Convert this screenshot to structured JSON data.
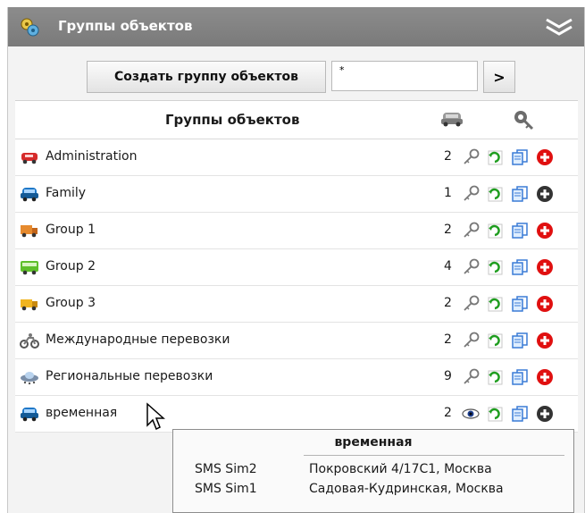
{
  "window": {
    "title": "Группы объектов"
  },
  "toolbar": {
    "create_label": "Создать группу объектов",
    "search_value": "*",
    "next_label": ">"
  },
  "table": {
    "header": "Группы объектов",
    "rows": [
      {
        "name": "Administration",
        "count": "2",
        "icon": "red-car-icon",
        "deletable": true,
        "viewonly": false
      },
      {
        "name": "Family",
        "count": "1",
        "icon": "blue-car-icon",
        "deletable": false,
        "viewonly": false
      },
      {
        "name": "Group 1",
        "count": "2",
        "icon": "orange-truck-icon",
        "deletable": true,
        "viewonly": false
      },
      {
        "name": "Group 2",
        "count": "4",
        "icon": "green-bus-icon",
        "deletable": true,
        "viewonly": false
      },
      {
        "name": "Group 3",
        "count": "2",
        "icon": "yellow-truck-icon",
        "deletable": true,
        "viewonly": false
      },
      {
        "name": "Международные перевозки",
        "count": "2",
        "icon": "motorcycle-icon",
        "deletable": true,
        "viewonly": false
      },
      {
        "name": "Региональные перевозки",
        "count": "9",
        "icon": "ufo-icon",
        "deletable": true,
        "viewonly": false
      },
      {
        "name": "временная",
        "count": "2",
        "icon": "blue-car-icon",
        "deletable": false,
        "viewonly": true
      }
    ]
  },
  "tooltip": {
    "title": "временная",
    "items": [
      {
        "phone": "SMS Sim2",
        "address": "Покровский 4/17С1, Москва"
      },
      {
        "phone": "SMS Sim1",
        "address": "Садовая-Кудринская, Москва"
      }
    ]
  },
  "colors": {
    "title_bar": "#808080",
    "delete_active": "#e01010",
    "delete_disabled": "#333333",
    "copy": "#3a7bd5",
    "refresh": "#1f9d1f"
  }
}
